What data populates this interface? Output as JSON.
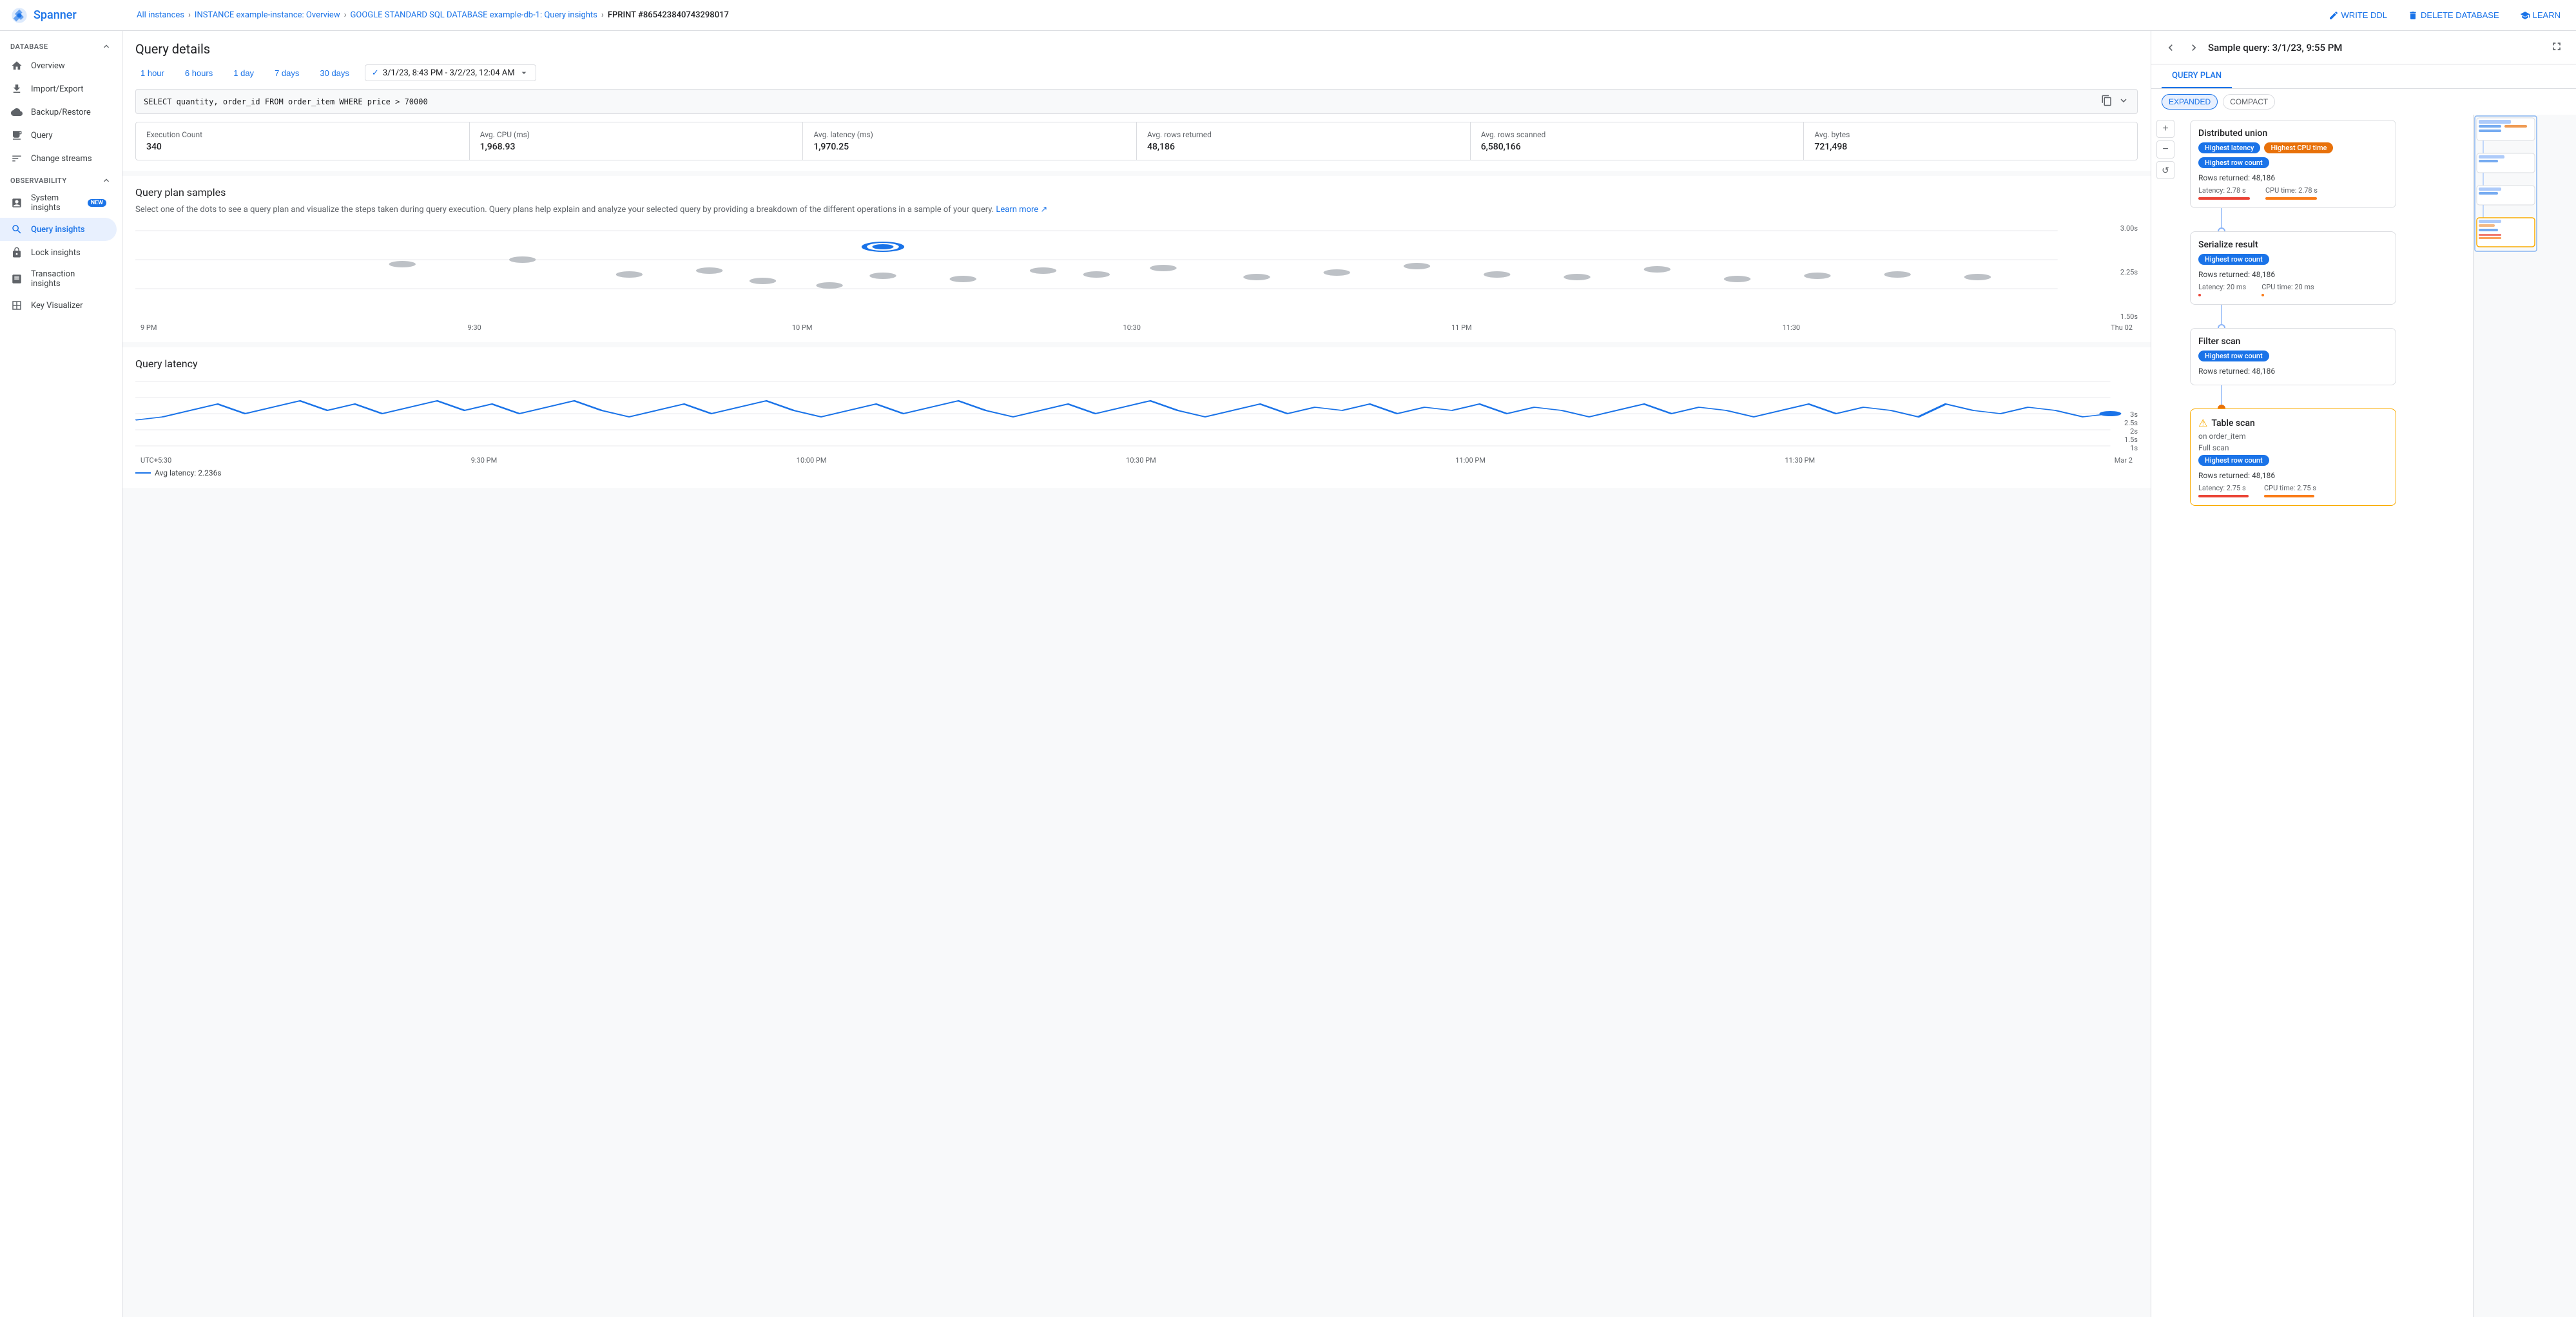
{
  "topbar": {
    "app_name": "Spanner",
    "breadcrumbs": [
      {
        "label": "All instances",
        "link": true
      },
      {
        "label": "INSTANCE example-instance: Overview",
        "link": true
      },
      {
        "label": "GOOGLE STANDARD SQL DATABASE example-db-1: Query insights",
        "link": true
      },
      {
        "label": "FPRINT #865423840743298017",
        "link": false
      }
    ],
    "actions": [
      {
        "label": "WRITE DDL",
        "icon": "edit-icon"
      },
      {
        "label": "DELETE DATABASE",
        "icon": "delete-icon"
      },
      {
        "label": "LEARN",
        "icon": "book-icon"
      }
    ]
  },
  "sidebar": {
    "database_section": "DATABASE",
    "database_items": [
      {
        "label": "Overview",
        "icon": "home-icon",
        "active": false
      },
      {
        "label": "Import/Export",
        "icon": "import-icon",
        "active": false
      },
      {
        "label": "Backup/Restore",
        "icon": "backup-icon",
        "active": false
      },
      {
        "label": "Query",
        "icon": "query-icon",
        "active": false
      },
      {
        "label": "Change streams",
        "icon": "stream-icon",
        "active": false
      }
    ],
    "observability_section": "OBSERVABILITY",
    "observability_items": [
      {
        "label": "System insights",
        "badge": "NEW",
        "icon": "insight-icon",
        "active": false
      },
      {
        "label": "Query insights",
        "badge": "",
        "icon": "query-insight-icon",
        "active": true
      },
      {
        "label": "Lock insights",
        "badge": "",
        "icon": "lock-icon",
        "active": false
      },
      {
        "label": "Transaction insights",
        "badge": "",
        "icon": "transaction-icon",
        "active": false
      },
      {
        "label": "Key Visualizer",
        "badge": "",
        "icon": "key-icon",
        "active": false
      }
    ]
  },
  "query_details": {
    "title": "Query details",
    "time_options": [
      "1 hour",
      "6 hours",
      "1 day",
      "7 days",
      "30 days"
    ],
    "time_range": "3/1/23, 8:43 PM - 3/2/23, 12:04 AM",
    "query_sql": "SELECT quantity, order_id FROM order_item WHERE price > 70000",
    "stats": [
      {
        "label": "Execution Count",
        "value": "340"
      },
      {
        "label": "Avg. CPU (ms)",
        "value": "1,968.93"
      },
      {
        "label": "Avg. latency (ms)",
        "value": "1,970.25"
      },
      {
        "label": "Avg. rows returned",
        "value": "48,186"
      },
      {
        "label": "Avg. rows scanned",
        "value": "6,580,166"
      },
      {
        "label": "Avg. bytes",
        "value": "721,498"
      }
    ]
  },
  "query_plan_samples": {
    "title": "Query plan samples",
    "description": "Select one of the dots to see a query plan and visualize the steps taken during query execution. Query plans help explain and analyze your selected query by providing a breakdown of the different operations in a sample of your query.",
    "learn_more": "Learn more",
    "scatter_y_labels": [
      "3.00s",
      "2.25s",
      "1.50s"
    ],
    "scatter_x_labels": [
      "9 PM",
      "9:30",
      "10 PM",
      "10:30",
      "11 PM",
      "11:30",
      "Thu 02"
    ]
  },
  "query_latency": {
    "title": "Query latency",
    "y_labels": [
      "3s",
      "2.5s",
      "2s",
      "1.5s",
      "1s"
    ],
    "x_labels": [
      "UTC+5:30",
      "9:30 PM",
      "10:00 PM",
      "10:30 PM",
      "11:00 PM",
      "11:30 PM",
      "Mar 2"
    ],
    "legend": "Avg latency: 2.236s"
  },
  "right_panel": {
    "title": "Sample query: 3/1/23, 9:55 PM",
    "tabs": [
      "QUERY PLAN"
    ],
    "active_tab": "QUERY PLAN",
    "view_modes": [
      "EXPANDED",
      "COMPACT"
    ],
    "active_view": "EXPANDED",
    "nodes": [
      {
        "title": "Distributed union",
        "badges": [
          "Highest latency",
          "Highest CPU time",
          "Highest row count"
        ],
        "badge_colors": [
          "blue",
          "orange",
          "blue"
        ],
        "rows_returned": "Rows returned: 48,186",
        "latency_label": "Latency: 2.78 s",
        "cpu_label": "CPU time: 2.78 s",
        "latency_bar_color": "red",
        "cpu_bar_color": "orange",
        "warn": false,
        "subtitle": ""
      },
      {
        "title": "Serialize result",
        "badges": [
          "Highest row count"
        ],
        "badge_colors": [
          "blue"
        ],
        "rows_returned": "Rows returned: 48,186",
        "latency_label": "Latency: 20 ms",
        "cpu_label": "CPU time: 20 ms",
        "latency_bar_color": "red-sm",
        "cpu_bar_color": "orange-sm",
        "warn": false,
        "subtitle": ""
      },
      {
        "title": "Filter scan",
        "badges": [
          "Highest row count"
        ],
        "badge_colors": [
          "blue"
        ],
        "rows_returned": "Rows returned: 48,186",
        "latency_label": "",
        "cpu_label": "",
        "warn": false,
        "subtitle": ""
      },
      {
        "title": "Table scan",
        "badges": [
          "Highest row count"
        ],
        "badge_colors": [
          "blue"
        ],
        "rows_returned": "Rows returned: 48,186",
        "subtitle": "on order_item",
        "scan_type": "Full scan",
        "latency_label": "Latency: 2.75 s",
        "cpu_label": "CPU time: 2.75 s",
        "latency_bar_color": "red",
        "cpu_bar_color": "orange",
        "warn": true
      }
    ],
    "badge_labels": {
      "highest_latency": "Highest latency",
      "highest_cpu": "Highest CPU time",
      "highest_row": "Highest row count"
    }
  }
}
